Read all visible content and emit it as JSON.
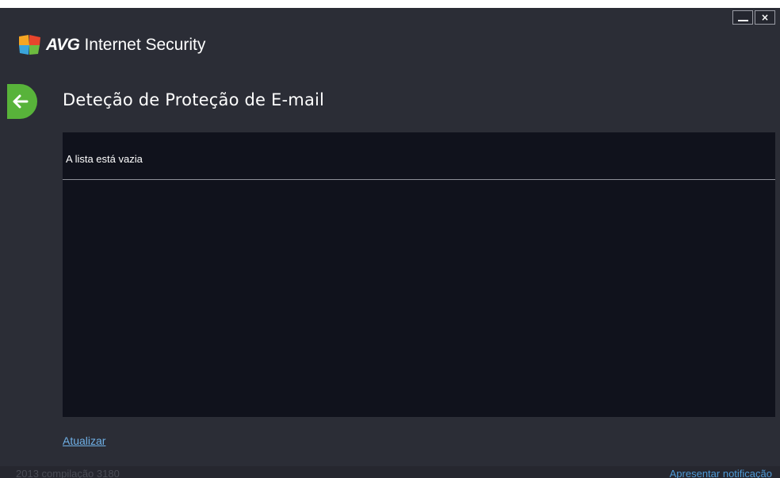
{
  "window": {
    "brand": "AVG",
    "product": "Internet Security",
    "controls": {
      "minimize_icon": "minimize-icon",
      "close_icon": "close-icon"
    }
  },
  "header": {
    "back_icon": "arrow-left-icon",
    "title": "Deteção de Proteção de E-mail"
  },
  "list": {
    "empty_text": "A lista está vazia",
    "items": []
  },
  "actions": {
    "refresh_label": "Atualizar"
  },
  "footer": {
    "build_info": "2013 compilação 3180",
    "notify_label": "Apresentar notificação"
  },
  "colors": {
    "background": "#2b2d36",
    "panel": "#10121c",
    "accent_green": "#58b33a",
    "link": "#6fb0e6"
  }
}
